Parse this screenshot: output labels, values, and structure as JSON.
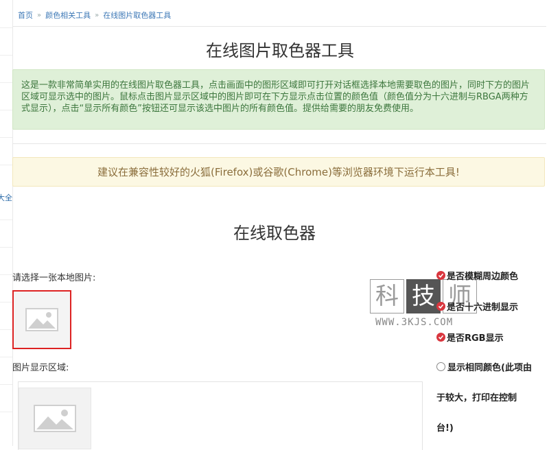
{
  "breadcrumb": [
    "首页",
    "颜色相关工具",
    "在线图片取色器工具"
  ],
  "sidebar_fragment": "大全",
  "page_title": "在线图片取色器工具",
  "intro": "这是一款非常简单实用的在线图片取色器工具，点击画面中的图形区域即可打开对话框选择本地需要取色的图片，同时下方的图片区域可显示选中的图片。鼠标点击图片显示区域中的图片即可在下方显示点击位置的颜色值（颜色值分为十六进制与RBGA两种方式显示），点击“显示所有颜色”按钮还可显示该选中图片的所有颜色值。提供给需要的朋友免费使用。",
  "browser_tip": "建议在兼容性较好的火狐(Firefox)或谷歌(Chrome)等浏览器环境下运行本工具!",
  "picker_title": "在线取色器",
  "select_label": "请选择一张本地图片:",
  "display_label": "图片显示区域:",
  "options": {
    "blur": "是否模糊周边颜色",
    "hex": "是否十六进制显示",
    "rgb": "是否RGB显示",
    "same_line1": "显示相同颜色(此项由",
    "same_line2": "于较大，打印在控制",
    "same_line3": "台!)"
  },
  "watermark": {
    "chars": [
      "科",
      "技",
      "师"
    ],
    "url": "WWW.3KJS.COM"
  },
  "colors": {
    "check": "#d9363e",
    "info_bg": "#dff0d8",
    "warn_bg": "#fcf8e3",
    "highlight": "#dd2222"
  }
}
